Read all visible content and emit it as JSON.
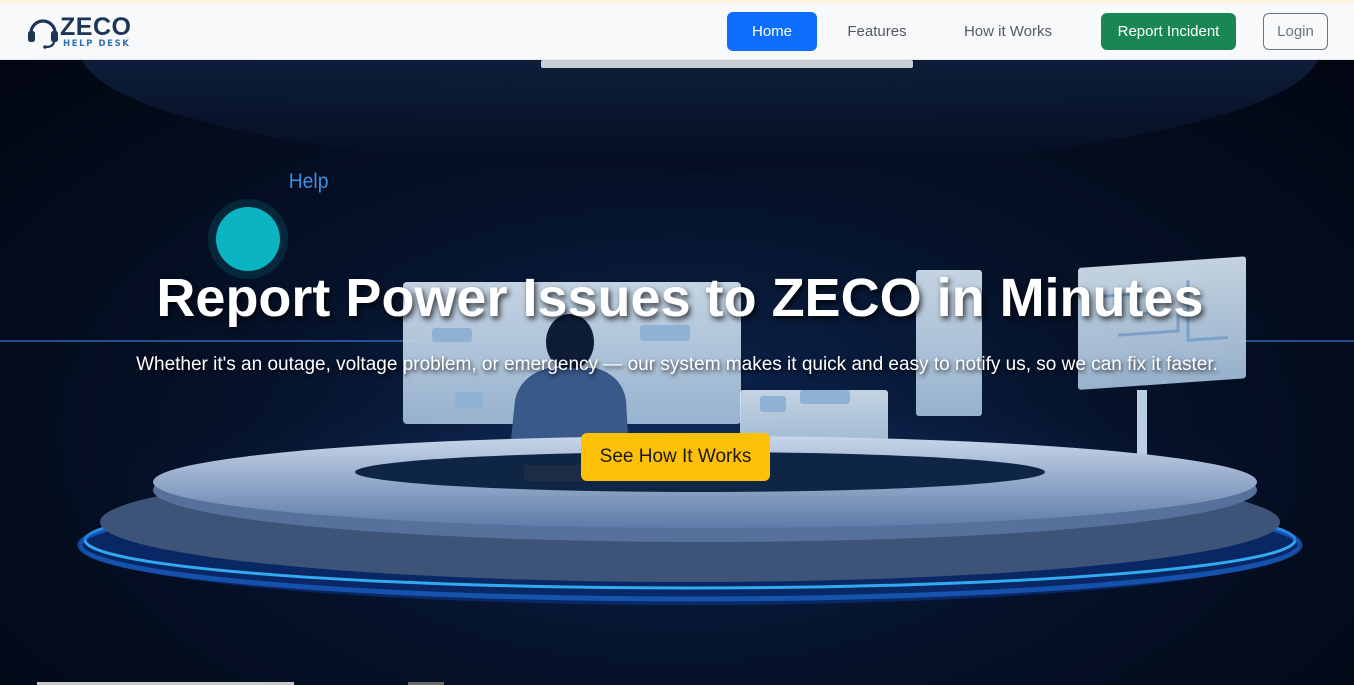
{
  "brand": {
    "name": "ZECO",
    "subtitle": "HELP DESK"
  },
  "nav": {
    "home": "Home",
    "features": "Features",
    "how_it_works": "How it Works",
    "report_incident": "Report Incident",
    "login": "Login"
  },
  "hero": {
    "help_sign": "Help",
    "title": "Report Power Issues to ZECO in Minutes",
    "subtitle": "Whether it's an outage, voltage problem, or emergency — our system makes it quick and easy to notify us, so we can fix it faster.",
    "cta": "See How It Works"
  },
  "colors": {
    "primary": "#0d6efd",
    "success": "#198754",
    "warning": "#ffc107",
    "brand_dark": "#1d3557"
  }
}
